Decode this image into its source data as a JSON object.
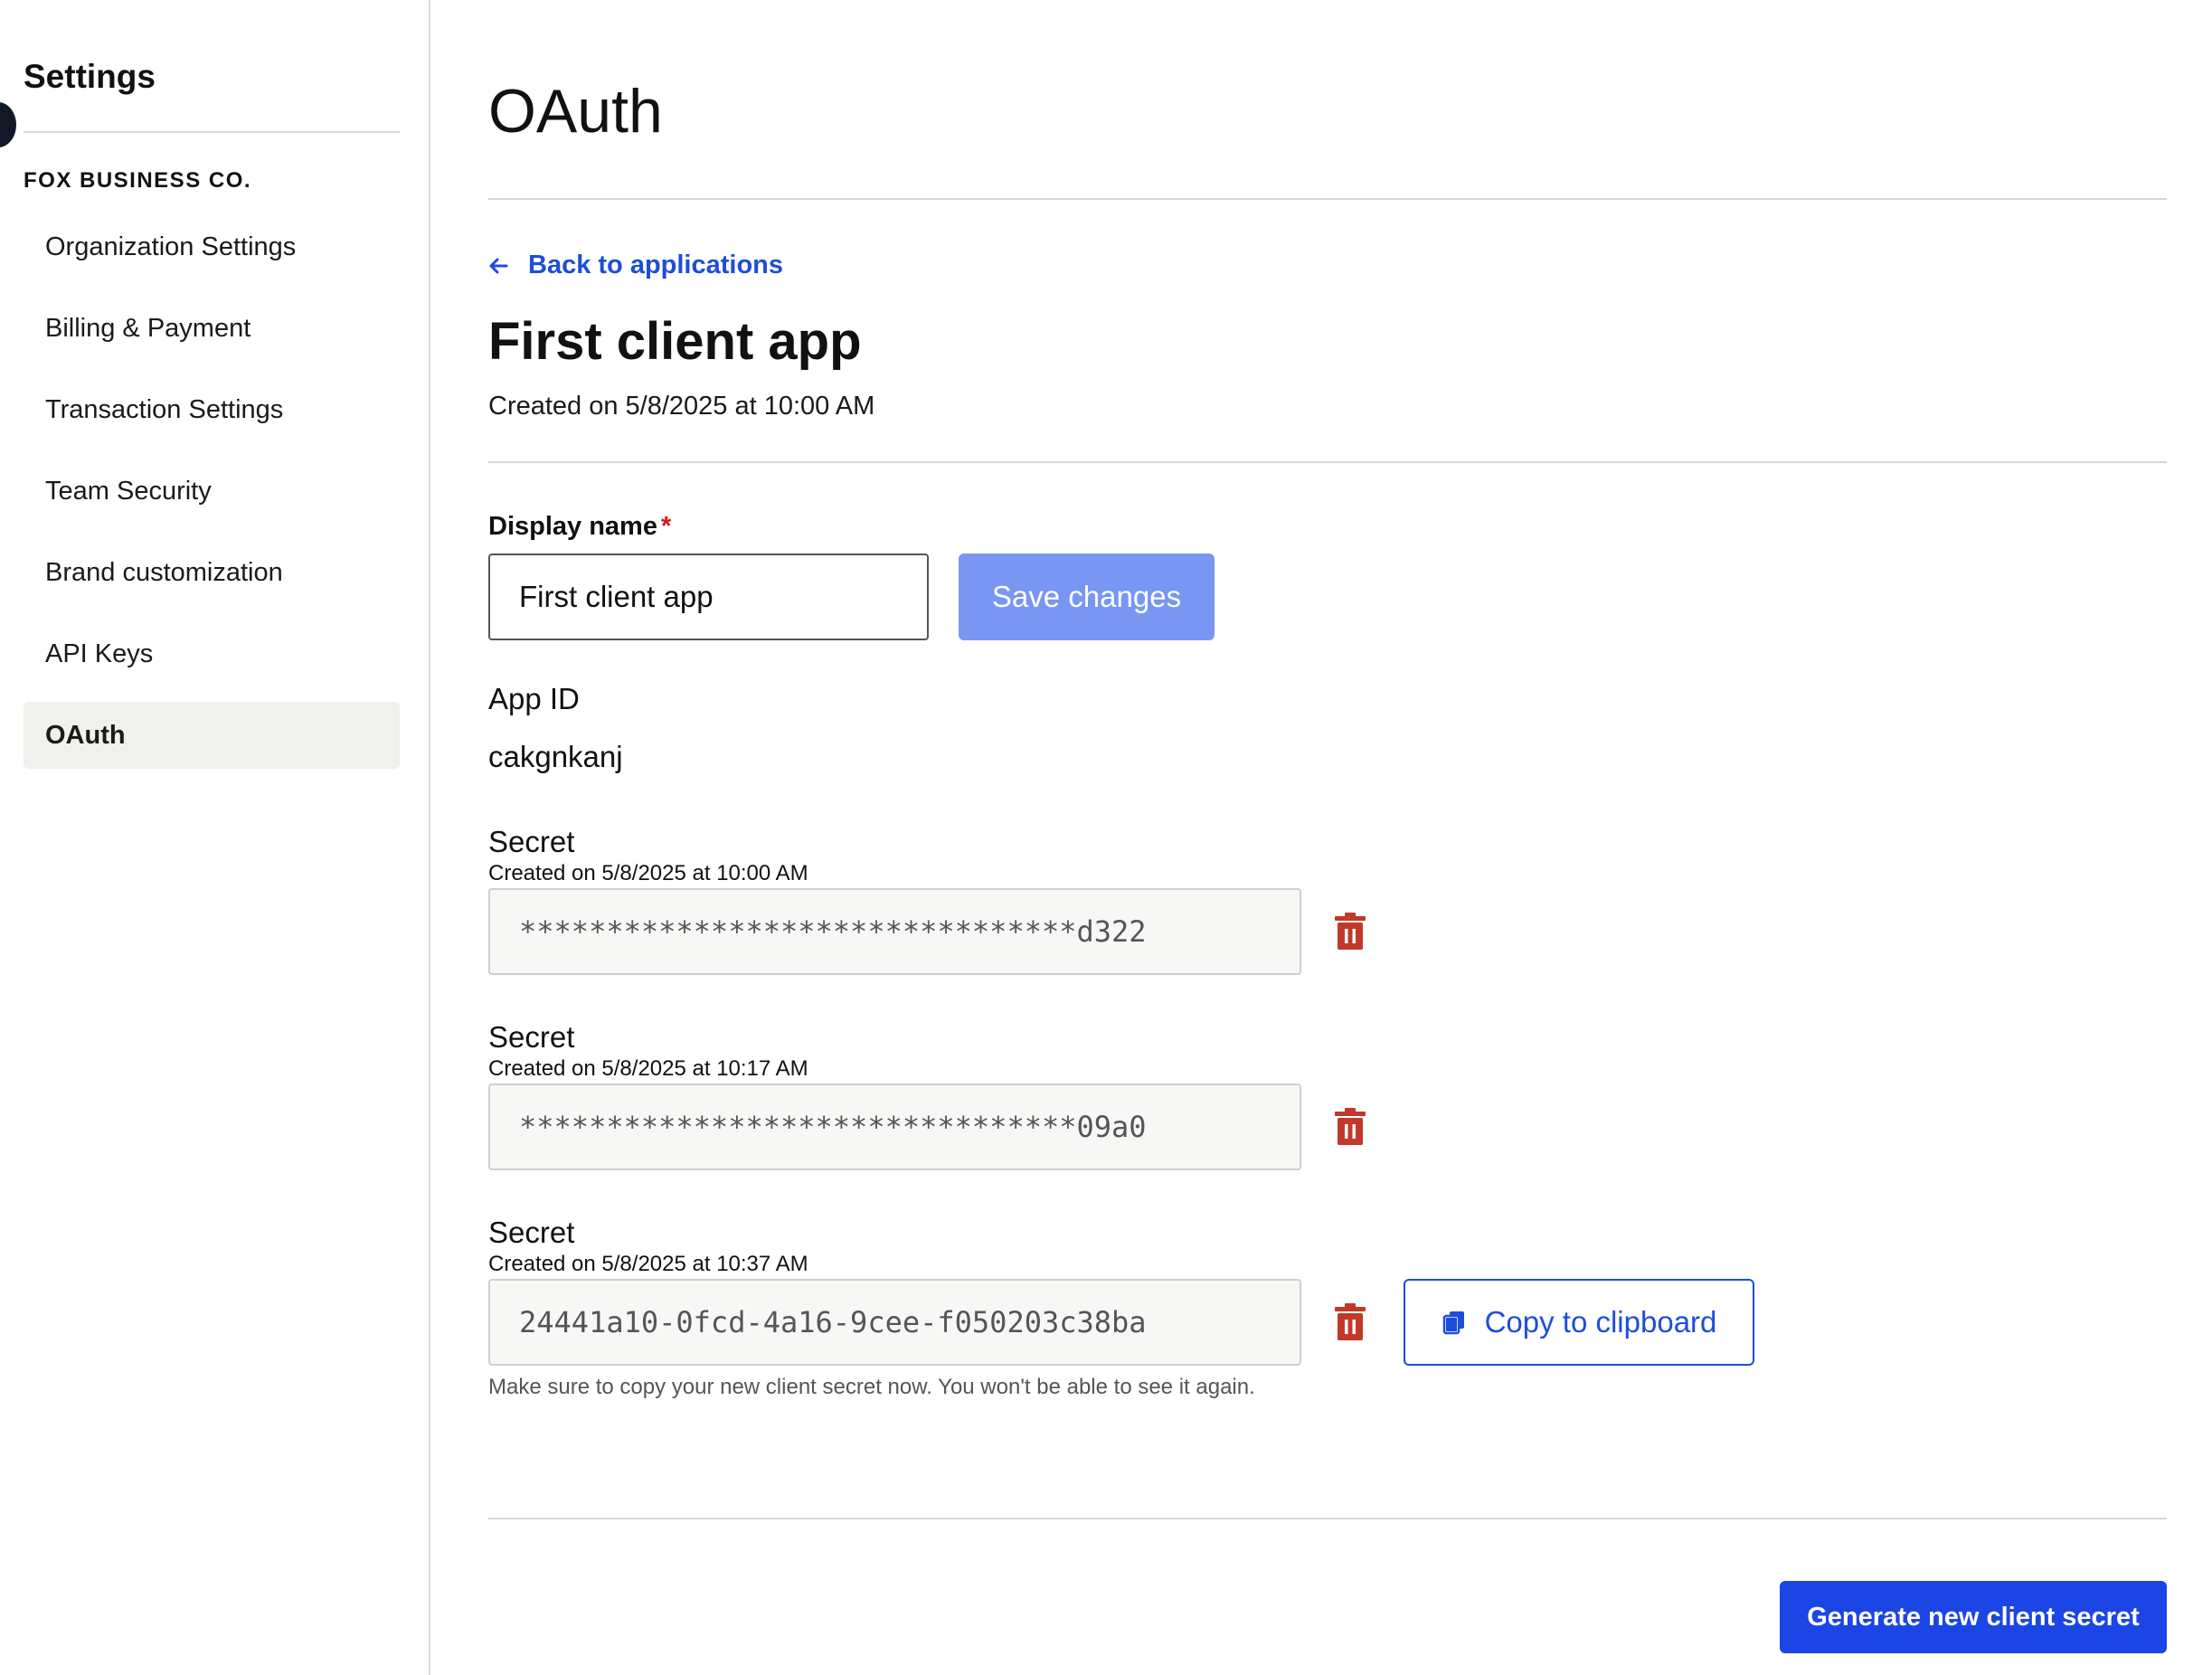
{
  "sidebar": {
    "title": "Settings",
    "org_name": "FOX BUSINESS CO.",
    "items": [
      {
        "label": "Organization Settings",
        "active": false
      },
      {
        "label": "Billing & Payment",
        "active": false
      },
      {
        "label": "Transaction Settings",
        "active": false
      },
      {
        "label": "Team Security",
        "active": false
      },
      {
        "label": "Brand customization",
        "active": false
      },
      {
        "label": "API Keys",
        "active": false
      },
      {
        "label": "OAuth",
        "active": true
      }
    ]
  },
  "main": {
    "page_title": "OAuth",
    "back_link": "Back to applications",
    "app_title": "First client app",
    "app_created": "Created on 5/8/2025 at 10:00 AM",
    "display_name_label": "Display name",
    "required_marker": "*",
    "display_name_value": "First client app",
    "save_label": "Save changes",
    "app_id_label": "App ID",
    "app_id_value": "cakgnkanj",
    "secrets": [
      {
        "title": "Secret",
        "created": "Created on 5/8/2025 at 10:00 AM",
        "value": "********************************d322"
      },
      {
        "title": "Secret",
        "created": "Created on 5/8/2025 at 10:17 AM",
        "value": "********************************09a0"
      },
      {
        "title": "Secret",
        "created": "Created on 5/8/2025 at 10:37 AM",
        "value": "24441a10-0fcd-4a16-9cee-f050203c38ba"
      }
    ],
    "copy_label": "Copy to clipboard",
    "secret_help": "Make sure to copy your new client secret now. You won't be able to see it again.",
    "generate_label": "Generate new client secret"
  },
  "colors": {
    "accent": "#1c45e6",
    "link": "#1d4ed8",
    "save_disabled": "#7896f2",
    "danger": "#c0392b",
    "active_nav_bg": "#f0f0ec"
  },
  "icons": {
    "back": "arrow-left-icon",
    "delete": "trash-icon",
    "copy": "copy-icon"
  }
}
